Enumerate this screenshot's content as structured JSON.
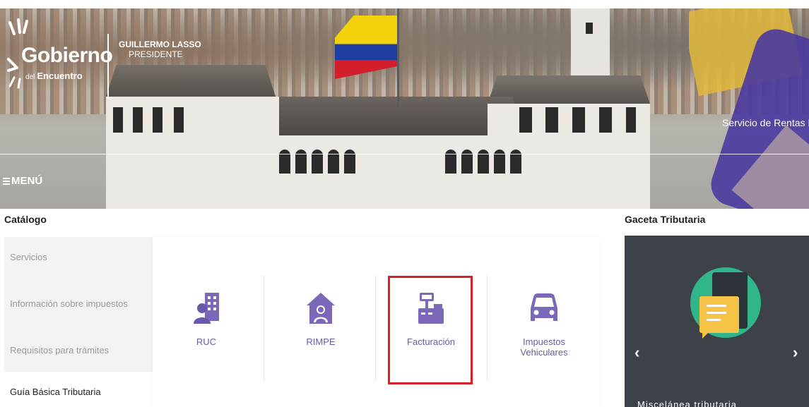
{
  "header": {
    "logo_main": "Gobierno",
    "logo_sub_small": "del",
    "logo_sub": "Encuentro",
    "president_name": "GUILLERMO LASSO",
    "president_title": "PRESIDENTE",
    "institution": "Servicio de Rentas Intern",
    "menu_label": "MENÚ"
  },
  "catalog": {
    "title": "Catálogo",
    "side_items": [
      {
        "label": "Servicios",
        "active": false
      },
      {
        "label": "Información sobre impuestos",
        "active": false
      },
      {
        "label": "Requisitos para trámites",
        "active": false
      },
      {
        "label": "Guía Básica Tributaria",
        "active": true
      }
    ],
    "cards": [
      {
        "label": "RUC",
        "icon": "building-user-icon"
      },
      {
        "label": "RIMPE",
        "icon": "house-user-icon"
      },
      {
        "label": "Facturación",
        "icon": "cash-register-icon",
        "highlighted": true
      },
      {
        "label_line1": "Impuestos",
        "label_line2": "Vehiculares",
        "icon": "car-icon"
      }
    ]
  },
  "gaceta": {
    "title": "Gaceta Tributaria",
    "prev_arrow": "‹",
    "next_arrow": "›",
    "caption": "Miscelánea tributaria"
  },
  "colors": {
    "accent_purple": "#7b68b8",
    "highlight_red": "#d92027",
    "gaceta_bg": "#3c4247"
  }
}
